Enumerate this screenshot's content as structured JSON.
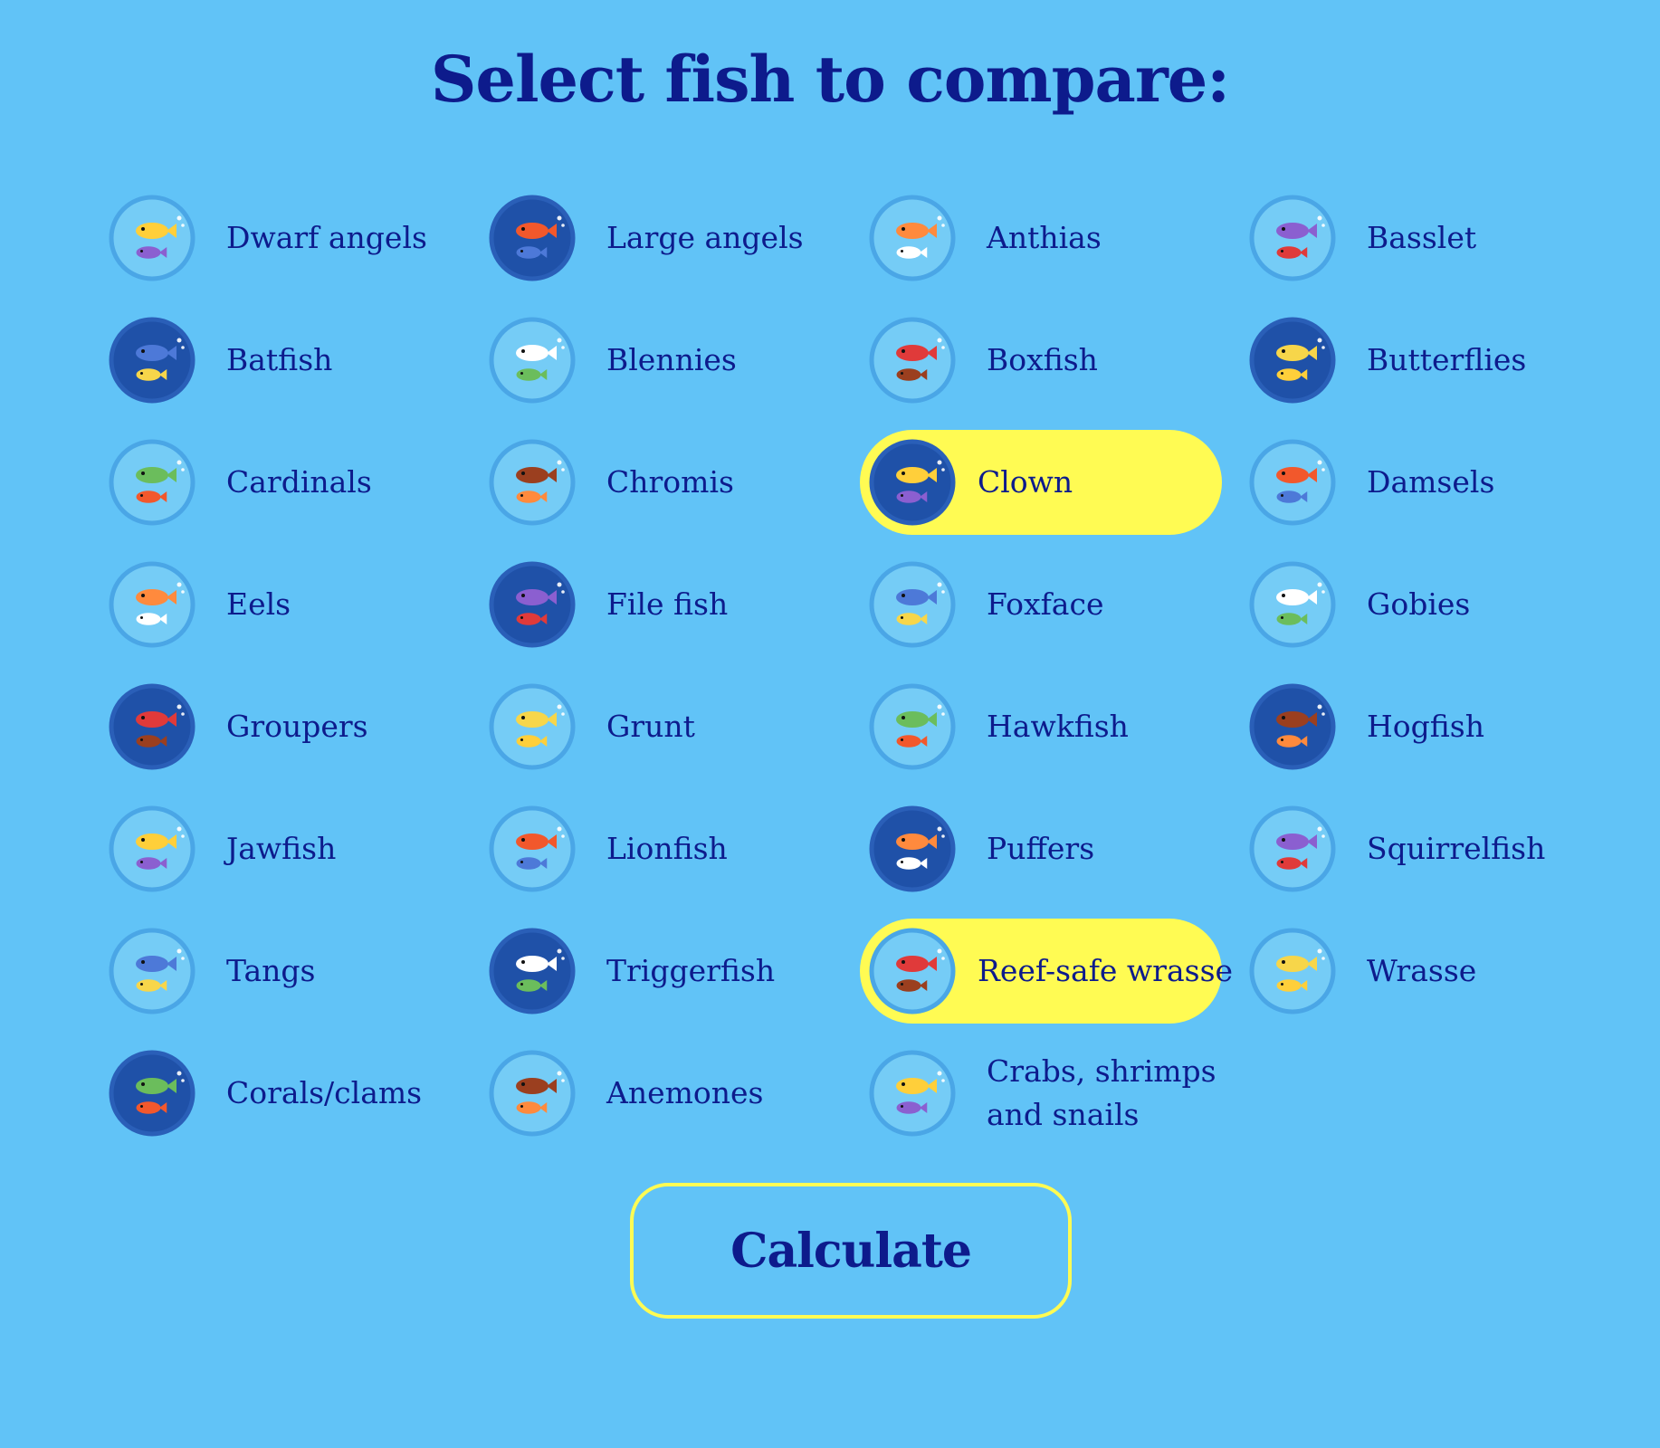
{
  "page": {
    "title": "Select fish to compare:"
  },
  "colors": {
    "background": "#61c3f7",
    "text": "#0d1b8c",
    "selected_highlight": "#fffb53",
    "icon_circle_light": "#75ccf6",
    "icon_circle_dark": "#1f51a8",
    "icon_ring": "#4aa6e6"
  },
  "options": [
    {
      "label": "Dwarf angels",
      "icon": "dwarf-angels-icon",
      "dark": false,
      "selected": false
    },
    {
      "label": "Large angels",
      "icon": "large-angels-icon",
      "dark": true,
      "selected": false
    },
    {
      "label": "Anthias",
      "icon": "anthias-icon",
      "dark": false,
      "selected": false
    },
    {
      "label": "Basslet",
      "icon": "basslet-icon",
      "dark": false,
      "selected": false
    },
    {
      "label": "Batfish",
      "icon": "batfish-icon",
      "dark": true,
      "selected": false
    },
    {
      "label": "Blennies",
      "icon": "blennies-icon",
      "dark": false,
      "selected": false
    },
    {
      "label": "Boxfish",
      "icon": "boxfish-icon",
      "dark": false,
      "selected": false
    },
    {
      "label": "Butterflies",
      "icon": "butterflies-icon",
      "dark": true,
      "selected": false
    },
    {
      "label": "Cardinals",
      "icon": "cardinals-icon",
      "dark": false,
      "selected": false
    },
    {
      "label": "Chromis",
      "icon": "chromis-icon",
      "dark": false,
      "selected": false
    },
    {
      "label": "Clown",
      "icon": "clown-icon",
      "dark": true,
      "selected": true
    },
    {
      "label": "Damsels",
      "icon": "damsels-icon",
      "dark": false,
      "selected": false
    },
    {
      "label": "Eels",
      "icon": "eels-icon",
      "dark": false,
      "selected": false
    },
    {
      "label": "File fish",
      "icon": "file-fish-icon",
      "dark": true,
      "selected": false
    },
    {
      "label": "Foxface",
      "icon": "foxface-icon",
      "dark": false,
      "selected": false
    },
    {
      "label": "Gobies",
      "icon": "gobies-icon",
      "dark": false,
      "selected": false
    },
    {
      "label": "Groupers",
      "icon": "groupers-icon",
      "dark": true,
      "selected": false
    },
    {
      "label": "Grunt",
      "icon": "grunt-icon",
      "dark": false,
      "selected": false
    },
    {
      "label": "Hawkfish",
      "icon": "hawkfish-icon",
      "dark": false,
      "selected": false
    },
    {
      "label": "Hogfish",
      "icon": "hogfish-icon",
      "dark": true,
      "selected": false
    },
    {
      "label": "Jawfish",
      "icon": "jawfish-icon",
      "dark": false,
      "selected": false
    },
    {
      "label": "Lionfish",
      "icon": "lionfish-icon",
      "dark": false,
      "selected": false
    },
    {
      "label": "Puffers",
      "icon": "puffers-icon",
      "dark": true,
      "selected": false
    },
    {
      "label": "Squirrelfish",
      "icon": "squirrelfish-icon",
      "dark": false,
      "selected": false
    },
    {
      "label": "Tangs",
      "icon": "tangs-icon",
      "dark": false,
      "selected": false
    },
    {
      "label": "Triggerfish",
      "icon": "triggerfish-icon",
      "dark": true,
      "selected": false
    },
    {
      "label": "Reef-safe wrasse",
      "icon": "reef-safe-wrasse-icon",
      "dark": false,
      "selected": true
    },
    {
      "label": "Wrasse",
      "icon": "wrasse-icon",
      "dark": false,
      "selected": false
    },
    {
      "label": "Corals/clams",
      "icon": "corals-clams-icon",
      "dark": true,
      "selected": false
    },
    {
      "label": "Anemones",
      "icon": "anemones-icon",
      "dark": false,
      "selected": false
    },
    {
      "label": "Crabs, shrimps and snails",
      "icon": "crabs-shrimps-snails-icon",
      "dark": false,
      "selected": false
    }
  ],
  "actions": {
    "calculate_label": "Calculate"
  }
}
